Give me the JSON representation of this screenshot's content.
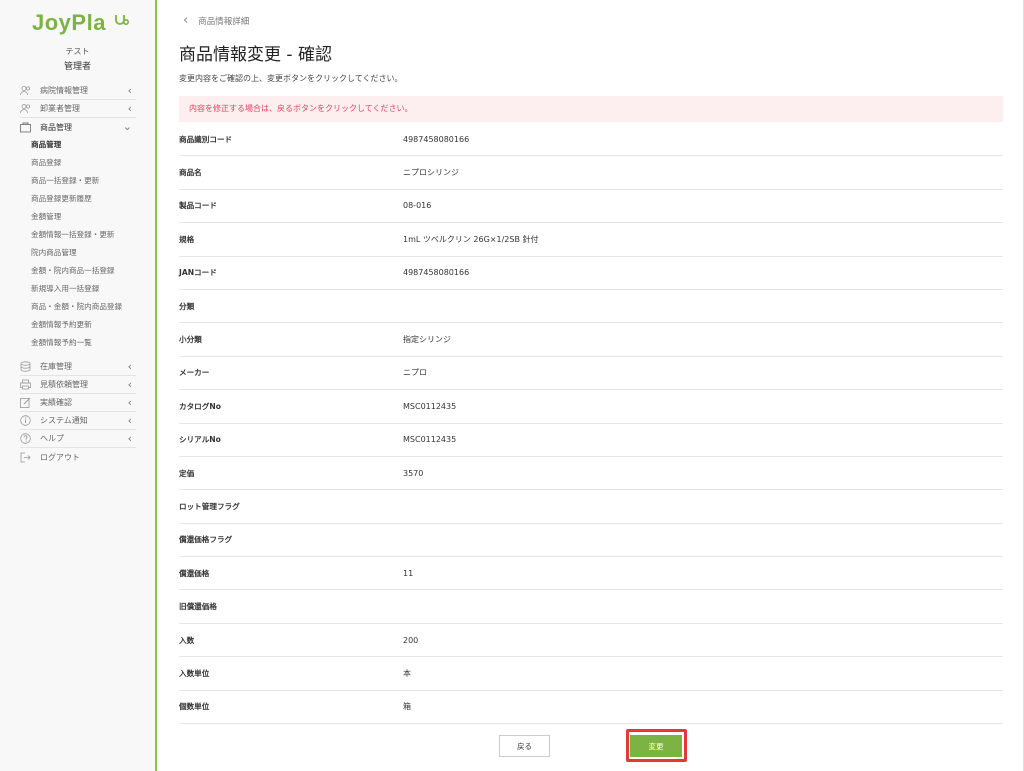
{
  "brand": {
    "logo_text": "JoyPla",
    "accent": "#7cb342",
    "alert_color": "#e0445f",
    "highlight_color": "#e53935"
  },
  "user": {
    "name": "テスト",
    "role": "管理者"
  },
  "sidebar": {
    "items": [
      {
        "label": "病院情報管理",
        "icon": "users-icon"
      },
      {
        "label": "卸業者管理",
        "icon": "users-icon"
      },
      {
        "label": "商品管理",
        "icon": "box-icon"
      }
    ],
    "sub_items": [
      "商品管理",
      "商品登録",
      "商品一括登録・更新",
      "商品登録更新履歴",
      "金額管理",
      "金額情報一括登録・更新",
      "院内商品管理",
      "金額・院内商品一括登録",
      "新規導入用一括登録",
      "商品・金額・院内商品登録",
      "金額情報予約更新",
      "金額情報予約一覧"
    ],
    "bottom_items": [
      {
        "label": "在庫管理",
        "icon": "database-icon"
      },
      {
        "label": "見積依頼管理",
        "icon": "printer-icon"
      },
      {
        "label": "実績確認",
        "icon": "edit-icon"
      },
      {
        "label": "システム通知",
        "icon": "info-icon"
      },
      {
        "label": "ヘルプ",
        "icon": "question-icon"
      },
      {
        "label": "ログアウト",
        "icon": "logout-icon"
      }
    ]
  },
  "main": {
    "breadcrumb": "商品情報詳細",
    "title": "商品情報変更 - 確認",
    "description": "変更内容をご確認の上、変更ボタンをクリックしてください。",
    "alert": "内容を修正する場合は、戻るボタンをクリックしてください。",
    "rows": [
      {
        "label": "商品識別コード",
        "value": "4987458080166"
      },
      {
        "label": "商品名",
        "value": "ニプロシリンジ"
      },
      {
        "label": "製品コード",
        "value": "08-016"
      },
      {
        "label": "規格",
        "value": "1mL ツベルクリン 26G×1/2SB 針付"
      },
      {
        "label": "JANコード",
        "value": "4987458080166"
      },
      {
        "label": "分類",
        "value": ""
      },
      {
        "label": "小分類",
        "value": "指定シリンジ"
      },
      {
        "label": "メーカー",
        "value": "ニプロ"
      },
      {
        "label": "カタログNo",
        "value": "MSC0112435"
      },
      {
        "label": "シリアルNo",
        "value": "MSC0112435"
      },
      {
        "label": "定価",
        "value": "3570"
      },
      {
        "label": "ロット管理フラグ",
        "value": ""
      },
      {
        "label": "償還価格フラグ",
        "value": ""
      },
      {
        "label": "償還価格",
        "value": "11"
      },
      {
        "label": "旧償還価格",
        "value": ""
      },
      {
        "label": "入数",
        "value": "200"
      },
      {
        "label": "入数単位",
        "value": "本"
      },
      {
        "label": "個数単位",
        "value": "箱"
      }
    ],
    "back_label": "戻る",
    "submit_label": "変更"
  }
}
